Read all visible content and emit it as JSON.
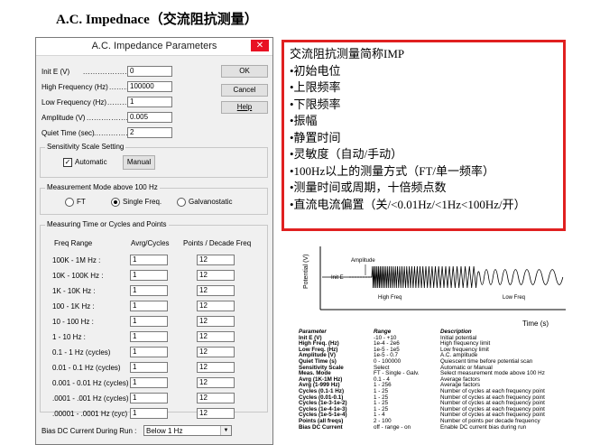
{
  "heading": "A.C. Impednace（交流阻抗测量）",
  "dialog": {
    "title": "A.C. Impedance Parameters",
    "close": "✕",
    "fields": [
      {
        "label": "Init E (V)",
        "value": "0"
      },
      {
        "label": "High Frequency (Hz)",
        "value": "100000"
      },
      {
        "label": "Low Frequency (Hz)",
        "value": "1"
      },
      {
        "label": "Amplitude (V)",
        "value": "0.005"
      },
      {
        "label": "Quiet Time (sec)",
        "value": "2"
      }
    ],
    "buttons": {
      "ok": "OK",
      "cancel": "Cancel",
      "help": "Help"
    },
    "sensitivity": {
      "title": "Sensitivity Scale Setting",
      "automatic": "Automatic",
      "manual": "Manual"
    },
    "mode": {
      "title": "Measurement Mode above 100 Hz",
      "options": [
        "FT",
        "Single Freq.",
        "Galvanostatic"
      ],
      "selected": "Single Freq."
    },
    "measuring": {
      "title": "Measuring Time or Cycles and Points",
      "headers": [
        "Freq Range",
        "Avrg/Cycles",
        "Points / Decade Freq"
      ],
      "rows": [
        {
          "range": "100K - 1M Hz :",
          "avg": "1",
          "pts": "12"
        },
        {
          "range": "10K - 100K Hz :",
          "avg": "1",
          "pts": "12"
        },
        {
          "range": "1K - 10K Hz :",
          "avg": "1",
          "pts": "12"
        },
        {
          "range": "100 - 1K Hz :",
          "avg": "1",
          "pts": "12"
        },
        {
          "range": "10 - 100 Hz :",
          "avg": "1",
          "pts": "12"
        },
        {
          "range": "1 - 10 Hz :",
          "avg": "1",
          "pts": "12"
        },
        {
          "range": "0.1 - 1 Hz (cycles)",
          "avg": "1",
          "pts": "12"
        },
        {
          "range": "0.01 - 0.1 Hz (cycles)",
          "avg": "1",
          "pts": "12"
        },
        {
          "range": "0.001 - 0.01 Hz (cycles)",
          "avg": "1",
          "pts": "12"
        },
        {
          "range": ".0001 - .001 Hz (cycles)",
          "avg": "1",
          "pts": "12"
        },
        {
          "range": ".00001 - .0001 Hz (cyc)",
          "avg": "1",
          "pts": "12"
        }
      ]
    },
    "bias": {
      "label": "Bias DC Current During Run :",
      "value": "Below 1 Hz"
    }
  },
  "note": {
    "lines": [
      "交流阻抗测量简称IMP",
      "•初始电位",
      "•上限频率",
      "•下限频率",
      "•振幅",
      "•静置时间",
      "•灵敏度（自动/手动）",
      "•100Hz以上的测量方式（FT/单一频率）",
      "•测量时间或周期，十倍频点数",
      "•直流电流偏置（关/<0.01Hz/<1Hz<100Hz/开）"
    ]
  },
  "diagram": {
    "ylabel": "Potential (V)",
    "amplitude": "Amplitude",
    "init_e": "Init E",
    "high_freq": "High Freq",
    "low_freq": "Low Freq",
    "time": "Time (s)"
  },
  "param_table": {
    "headers": [
      "Parameter",
      "Range",
      "Description"
    ],
    "params": [
      "Init E (V)",
      "High Freq. (Hz)",
      "Low Freq. (Hz)",
      "Amplitude (V)",
      "Quiet Time (s)",
      "Sensitivity Scale",
      "Meas. Mode",
      "Avrg (1K-1M Hz)",
      "Avrg (1-999 Hz)",
      "Cycles (0.1-1 Hz)",
      "Cycles (0.01-0.1)",
      "Cycles (1e-3-1e-2)",
      "Cycles (1e-4-1e-3)",
      "Cycles (1e-5-1e-4)",
      "Points (all freqs)",
      "Bias DC Current"
    ],
    "ranges": [
      "-10  -  +10",
      "1e-4  -  2e6",
      "1e-5  -  1e5",
      "1e-5  -  0.7",
      "0  -  100000",
      "Select",
      "FT - Single - Galv.",
      "0.1  -  4",
      "1  -  256",
      "1  -  25",
      "1  -  25",
      "1  -  25",
      "1  -  25",
      "1  -  4",
      "2  -  100",
      "off - range - on"
    ],
    "descriptions": [
      "Initial potential",
      "High frequency limit",
      "Low frequency limit",
      "A.C. amplitude",
      "Quiescent time before potential scan",
      "Automatic or Manual",
      "Select measurement mode above 100 Hz",
      "Average factors",
      "Average factors",
      "Number of cycles at each frequency point",
      "Number of cycles at each frequency point",
      "Number of cycles at each frequency point",
      "Number of cycles at each frequency point",
      "Number of cycles at each frequency point",
      "Number of points per decade frequency",
      "Enable DC current bias during run"
    ]
  }
}
